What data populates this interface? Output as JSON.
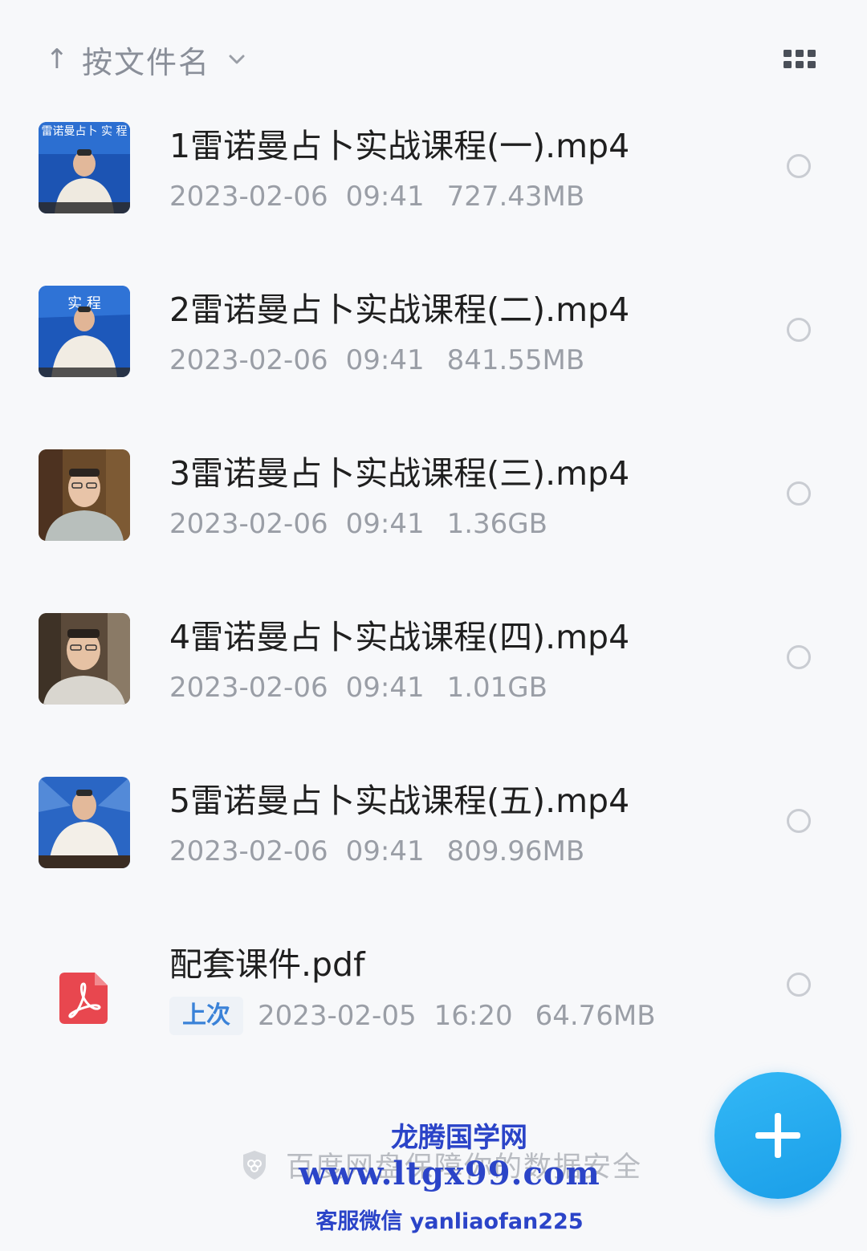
{
  "header": {
    "sort_arrow": "↑",
    "sort_label": "按文件名",
    "sort_chevron_icon": "chevron-down-icon",
    "view_toggle_icon": "grid-view-icon"
  },
  "files": [
    {
      "name": "1雷诺曼占卜实战课程(一).mp4",
      "date": "2023-02-06",
      "time": "09:41",
      "size": "727.43MB",
      "thumb_text": "雷诺曼占卜 实 程"
    },
    {
      "name": "2雷诺曼占卜实战课程(二).mp4",
      "date": "2023-02-06",
      "time": "09:41",
      "size": "841.55MB",
      "thumb_text": "实 程"
    },
    {
      "name": "3雷诺曼占卜实战课程(三).mp4",
      "date": "2023-02-06",
      "time": "09:41",
      "size": "1.36GB"
    },
    {
      "name": "4雷诺曼占卜实战课程(四).mp4",
      "date": "2023-02-06",
      "time": "09:41",
      "size": "1.01GB"
    },
    {
      "name": "5雷诺曼占卜实战课程(五).mp4",
      "date": "2023-02-06",
      "time": "09:41",
      "size": "809.96MB"
    },
    {
      "name": "配套课件.pdf",
      "badge": "上次",
      "date": "2023-02-05",
      "time": "16:20",
      "size": "64.76MB",
      "icon": "pdf-icon"
    }
  ],
  "footer": {
    "security_text": "百度网盘保障你的数据安全",
    "fab_icon": "plus-icon"
  },
  "watermark": {
    "name": "龙腾国学网",
    "url": "www.ltgx99.com",
    "contact": "客服微信 yanliaofan225"
  },
  "colors": {
    "background": "#f7f8fa",
    "fab": "#1fa8ee",
    "badge_text": "#3a82d8",
    "pdf_red": "#e8474f",
    "watermark": "#2b44c8"
  }
}
